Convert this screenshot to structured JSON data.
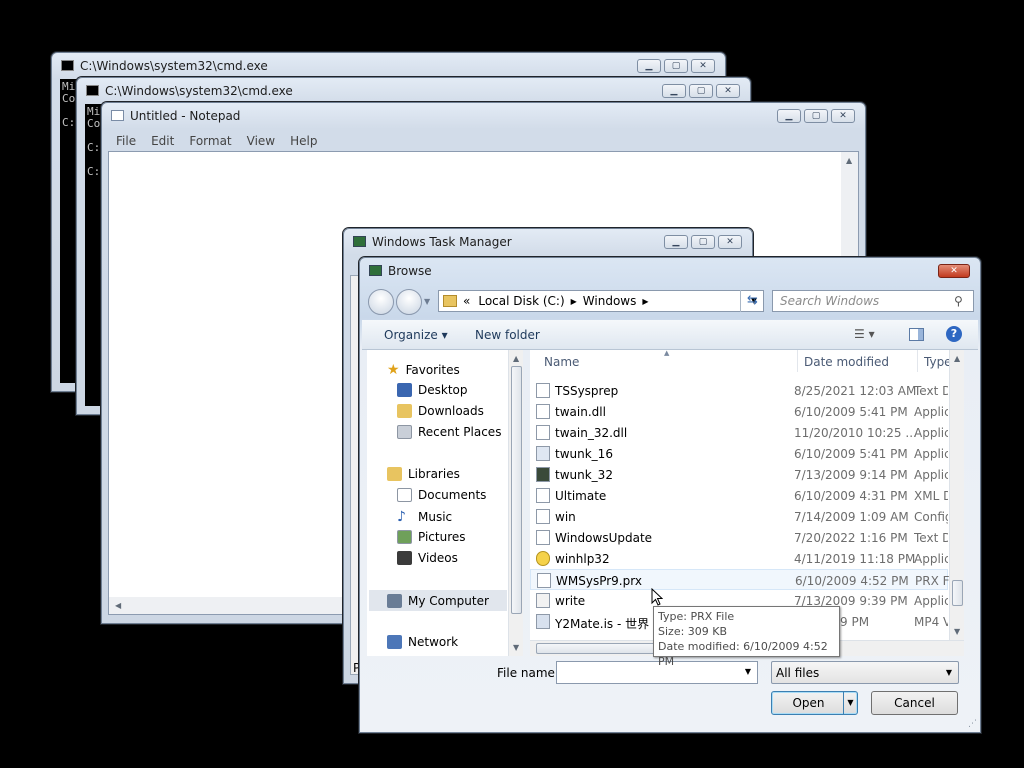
{
  "cmd1": {
    "title": "C:\\Windows\\system32\\cmd.exe",
    "lines": [
      "Mi",
      "Co",
      "",
      "C:"
    ]
  },
  "cmd2": {
    "title": "C:\\Windows\\system32\\cmd.exe",
    "lines": [
      "Mi",
      "Co",
      "",
      "C:",
      "",
      "C:"
    ]
  },
  "notepad": {
    "title": "Untitled - Notepad",
    "menu": [
      "File",
      "Edit",
      "Format",
      "View",
      "Help"
    ]
  },
  "taskmanager": {
    "title": "Windows Task Manager",
    "partial_label": "P"
  },
  "browse": {
    "title": "Browse",
    "breadcrumb": {
      "prefix": "«",
      "segments": [
        "Local Disk (C:)",
        "Windows"
      ]
    },
    "search_placeholder": "Search Windows",
    "toolbar": {
      "organize": "Organize ▾",
      "new_folder": "New folder"
    },
    "nav": {
      "favorites": "Favorites",
      "fav_items": [
        "Desktop",
        "Downloads",
        "Recent Places"
      ],
      "libraries": "Libraries",
      "lib_items": [
        "Documents",
        "Music",
        "Pictures",
        "Videos"
      ],
      "computer": "My Computer",
      "network": "Network"
    },
    "columns": [
      "Name",
      "Date modified",
      "Type"
    ],
    "files": [
      {
        "name": "TSSysprep",
        "date": "8/25/2021 12:03 AM",
        "type": "Text D"
      },
      {
        "name": "twain.dll",
        "date": "6/10/2009 5:41 PM",
        "type": "Applic"
      },
      {
        "name": "twain_32.dll",
        "date": "11/20/2010 10:25 ...",
        "type": "Applic"
      },
      {
        "name": "twunk_16",
        "date": "6/10/2009 5:41 PM",
        "type": "Applic"
      },
      {
        "name": "twunk_32",
        "date": "7/13/2009 9:14 PM",
        "type": "Applic"
      },
      {
        "name": "Ultimate",
        "date": "6/10/2009 4:31 PM",
        "type": "XML D"
      },
      {
        "name": "win",
        "date": "7/14/2009 1:09 AM",
        "type": "Config"
      },
      {
        "name": "WindowsUpdate",
        "date": "7/20/2022 1:16 PM",
        "type": "Text D"
      },
      {
        "name": "winhlp32",
        "date": "4/11/2019 11:18 PM",
        "type": "Applic"
      },
      {
        "name": "WMSysPr9.prx",
        "date": "6/10/2009 4:52 PM",
        "type": "PRX Fi"
      },
      {
        "name": "write",
        "date": "7/13/2009 9:39 PM",
        "type": "Applic"
      },
      {
        "name": "Y2Mate.is - 世界",
        "date": "22 12:49 PM",
        "type": "MP4 V"
      }
    ],
    "tooltip": {
      "type": "Type: PRX File",
      "size": "Size: 309 KB",
      "modified": "Date modified: 6/10/2009 4:52 PM"
    },
    "filename_label": "File name:",
    "filename_value": "",
    "filter": "All files",
    "open_label": "Open",
    "cancel_label": "Cancel"
  }
}
